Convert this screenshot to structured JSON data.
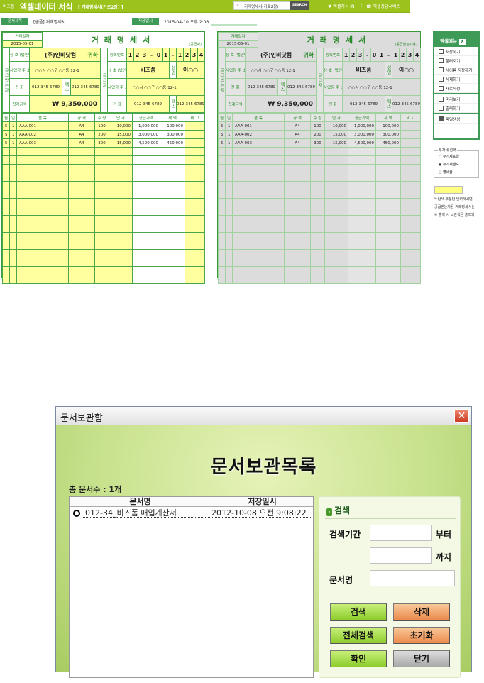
{
  "header": {
    "brand_small": "비즈폼",
    "brand": "엑셀데이터 서식",
    "subtitle": "[ 거래명세서(가로2장) ]",
    "search_value": "거래명세서(가로2장)",
    "search_button": "SEARCH",
    "link_1": "♥ 엑셀지식 IN",
    "link_sep": "|",
    "link_2": "☎ 엑셀상담서비스"
  },
  "docbar": {
    "title_label": "문서제목",
    "title_value": "[샘플] 거래명세서",
    "saved_label": "저장일시",
    "saved_value": "2015-04-10  오후 2:06"
  },
  "invoice": {
    "date_label": "거래일자",
    "date": "2015-05-01",
    "title": "거래명세서",
    "copies": [
      {
        "role": "(공급자)"
      },
      {
        "role": "(공급받는자용)"
      }
    ],
    "receiver_label": "공급받는자",
    "supplier_label": "공급자",
    "company_label": "상 호 (법인명)",
    "receiver_company": "(주)인비닷컴",
    "honorific": "귀하",
    "address_label": "사업장 주 소",
    "receiver_address": "○○시 ○○구 ○○동 12-1",
    "phone_label": "전 화",
    "receiver_phone": "012-345-6789",
    "fax_label": "팩스",
    "receiver_fax": "012-345-6789",
    "total_label": "합계금액",
    "total": "₩  9,350,000",
    "reg_label": "등록번호",
    "reg_digits": [
      "1",
      "2",
      "3",
      "-",
      "0",
      "1",
      "-",
      "1",
      "2",
      "3",
      "4",
      "5"
    ],
    "supplier_company": "비즈폼",
    "name_label": "성명",
    "supplier_name": "이○○",
    "supplier_address": "○○시 ○○구 ○○동 12-1",
    "supplier_phone": "012-345-6789",
    "supplier_fax": "012-345-6789",
    "columns": [
      "월",
      "일",
      "품    목",
      "규 격",
      "수 량",
      "단 가",
      "공급가액",
      "세 액",
      "비 고"
    ],
    "items": [
      [
        "5",
        "1",
        "AAA-001",
        "A4",
        "100",
        "10,000",
        "1,000,000",
        "100,000",
        ""
      ],
      [
        "5",
        "1",
        "AAA-002",
        "A4",
        "200",
        "15,000",
        "3,000,000",
        "300,000",
        ""
      ],
      [
        "5",
        "1",
        "AAA-003",
        "A4",
        "300",
        "15,000",
        "4,500,000",
        "450,000",
        ""
      ]
    ]
  },
  "sidebar": {
    "title": "엑셀메뉴",
    "items": [
      "저장하기",
      "불러오기",
      "새이름 저장하기",
      "삭제하기",
      "새로작성",
      "미리보기",
      "출력하기",
      "파일생성"
    ],
    "vat_legend": "부가세 선택",
    "vat_options": [
      "부가세포함",
      "부가세별도",
      "영세율"
    ],
    "vat_selected": 1,
    "notes": [
      "노란색 부분만 입력하시면",
      "공급받는자용 거래명세서는",
      "※ 출력 시 노란색은 출력되"
    ]
  },
  "dialog": {
    "title": "문서보관함",
    "heading": "문서보관목록",
    "count": "총 문서수 : 1개",
    "columns": [
      "문서명",
      "저장일시"
    ],
    "rows": [
      {
        "name": "012-34_비즈폼 매입계산서",
        "saved": "2012-10-08 오전 9:08:22"
      }
    ],
    "search": {
      "title": "검색",
      "period_label": "검색기간",
      "from": "부터",
      "to": "까지",
      "name_label": "문서명",
      "buttons": {
        "search": "검색",
        "delete": "삭제",
        "search_all": "전체검색",
        "reset": "초기화",
        "ok": "확인",
        "close": "닫기"
      }
    }
  }
}
